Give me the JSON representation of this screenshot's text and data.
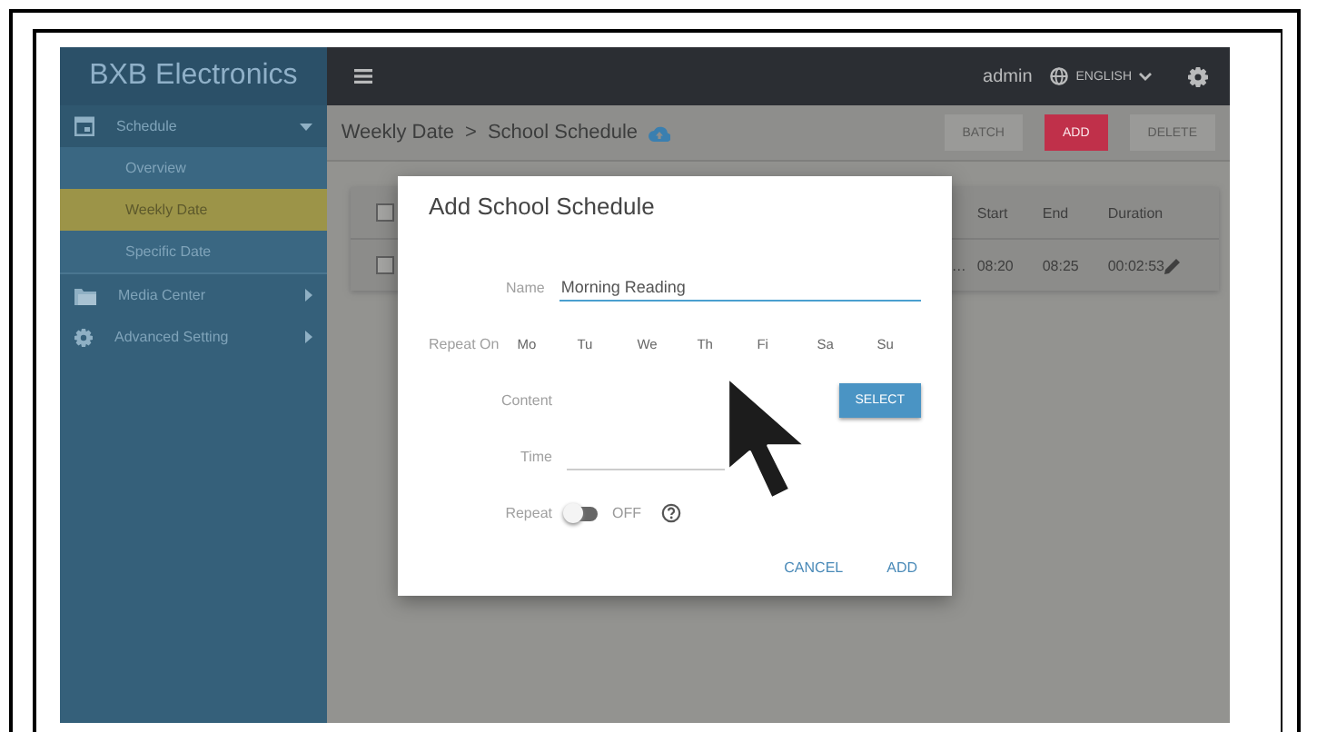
{
  "sidebar": {
    "brand": "BXB Electronics",
    "items": [
      {
        "label": "Schedule",
        "expanded": true,
        "children": [
          {
            "label": "Overview",
            "selected": false
          },
          {
            "label": "Weekly Date",
            "selected": true
          },
          {
            "label": "Specific Date",
            "selected": false
          }
        ]
      },
      {
        "label": "Media Center",
        "expanded": false
      },
      {
        "label": "Advanced Setting",
        "expanded": false
      }
    ]
  },
  "topbar": {
    "user": "admin",
    "language": "ENGLISH"
  },
  "breadcrumb": {
    "parent": "Weekly Date",
    "separator": ">",
    "current": "School Schedule"
  },
  "actions": [
    {
      "label": "BATCH",
      "kind": "plain",
      "disabled": true
    },
    {
      "label": "ADD",
      "kind": "primary",
      "disabled": false
    },
    {
      "label": "DELETE",
      "kind": "plain",
      "disabled": true
    }
  ],
  "table": {
    "select_all_checked": false,
    "columns": [
      "Start",
      "End",
      "Duration"
    ],
    "rows": [
      {
        "checked": false,
        "column_1": "…",
        "start": "08:20",
        "end": "08:25",
        "duration": "00:02:53"
      }
    ]
  },
  "dialog": {
    "title": "Add School Schedule",
    "fields": [
      {
        "kind": "text",
        "label": "Name",
        "value": "Morning Reading"
      },
      {
        "kind": "days",
        "label": "Repeat On",
        "days": [
          {
            "label": "Mo",
            "selected": false
          },
          {
            "label": "Tu",
            "selected": false
          },
          {
            "label": "We",
            "selected": false
          },
          {
            "label": "Th",
            "selected": false
          },
          {
            "label": "Fi",
            "selected": false
          },
          {
            "label": "Sa",
            "selected": false
          },
          {
            "label": "Su",
            "selected": false
          }
        ]
      },
      {
        "kind": "picker",
        "label": "Content",
        "button": "SELECT"
      },
      {
        "kind": "time",
        "label": "Time"
      },
      {
        "kind": "toggle",
        "label": "Repeat",
        "on": false,
        "state_text": "OFF"
      }
    ],
    "buttons": [
      "CANCEL",
      "ADD"
    ]
  }
}
